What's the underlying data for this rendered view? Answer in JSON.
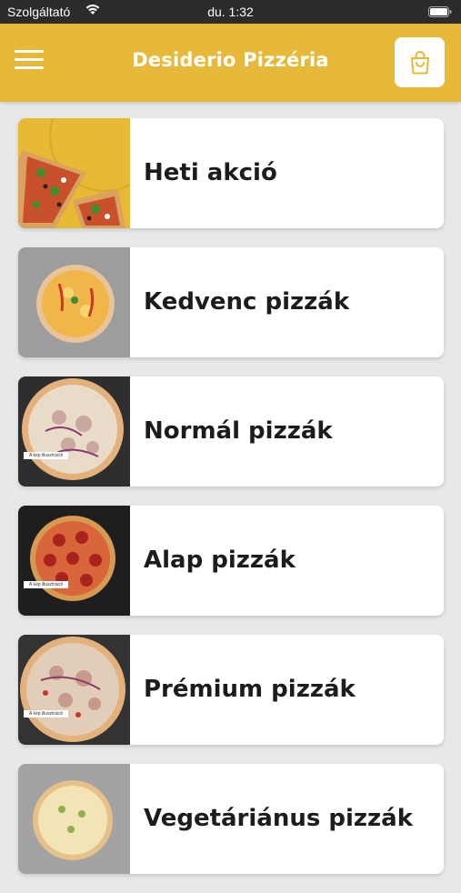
{
  "status_bar": {
    "carrier": "Szolgáltató",
    "time": "du. 1:32"
  },
  "header": {
    "title": "Desiderio Pizzéria",
    "accent_color": "#e7b93a",
    "menu_icon": "hamburger-menu-icon",
    "cart_icon": "shopping-bag-icon"
  },
  "categories": [
    {
      "label": "Heti akció",
      "thumb_bg": "#e8b934"
    },
    {
      "label": "Kedvenc pizzák",
      "thumb_bg": "#9d9d9d"
    },
    {
      "label": "Normál pizzák",
      "thumb_bg": "#2e2e2e",
      "caption": "A kép illusztráció"
    },
    {
      "label": "Alap pizzák",
      "thumb_bg": "#1e1e1e",
      "caption": "A kép illusztráció"
    },
    {
      "label": "Prémium pizzák",
      "thumb_bg": "#333333",
      "caption": "A kép illusztráció"
    },
    {
      "label": "Vegetáriánus pizzák",
      "thumb_bg": "#a3a3a3"
    }
  ]
}
